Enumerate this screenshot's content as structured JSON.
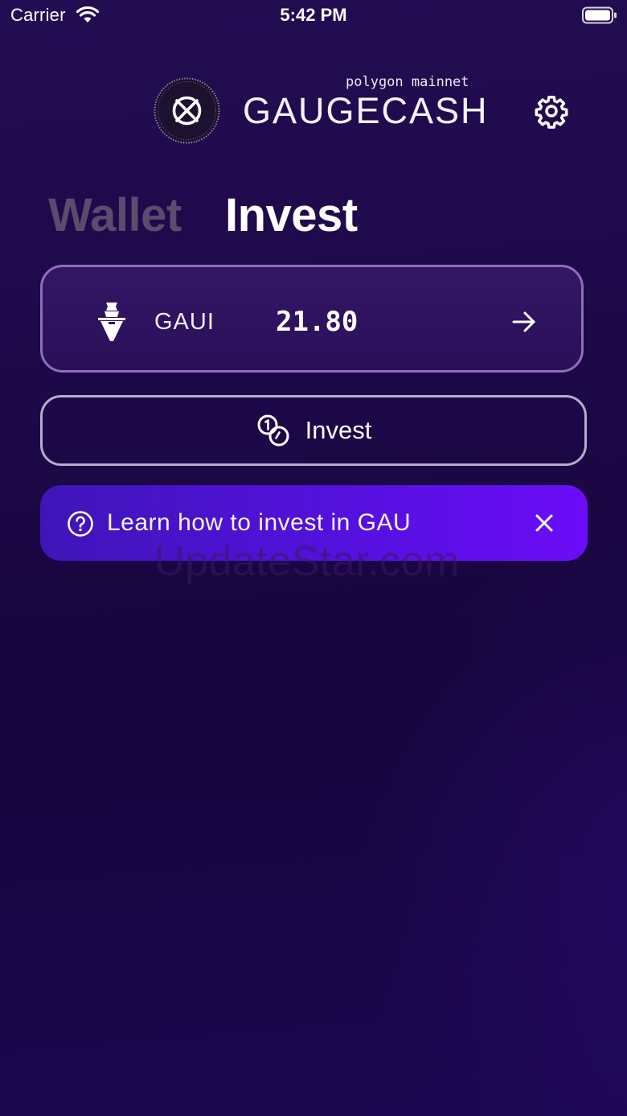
{
  "status_bar": {
    "carrier": "Carrier",
    "time": "5:42 PM"
  },
  "header": {
    "network": "polygon mainnet",
    "brand": "GAUGECASH",
    "icons": [
      "gaugecash-logo-icon",
      "gear-icon"
    ]
  },
  "tabs": [
    {
      "label": "Wallet",
      "active": false
    },
    {
      "label": "Invest",
      "active": true
    }
  ],
  "token": {
    "symbol": "GAUI",
    "balance": "21.80",
    "icon": "gaui-token-icon"
  },
  "invest_button": {
    "label": "Invest",
    "icon": "coins-icon"
  },
  "banner": {
    "text": "Learn how to invest in GAU",
    "icon": "help-circle-icon"
  },
  "watermark": "UpdateStar.com",
  "colors": {
    "background": "#1d0848",
    "card_border": "#8d6fb8",
    "banner_start": "#3f15b8",
    "banner_end": "#6c0cf9",
    "inactive_tab": "#5b4b6c"
  }
}
